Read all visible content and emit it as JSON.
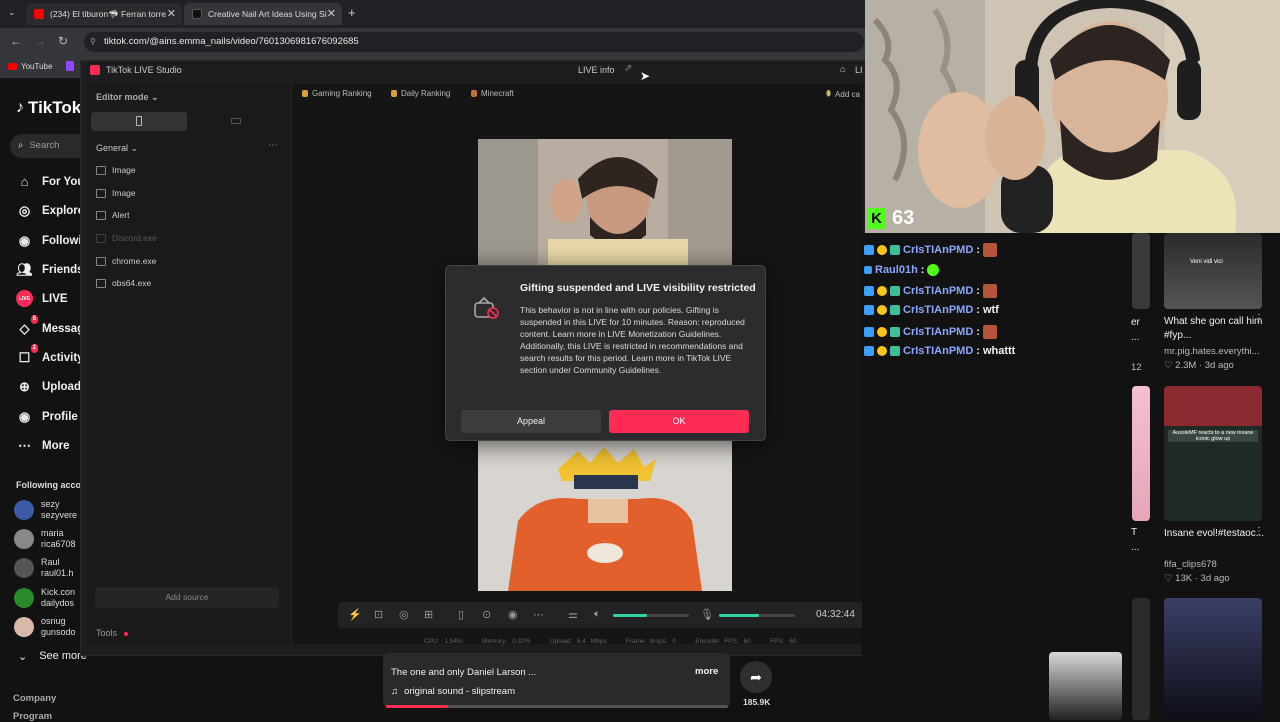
{
  "browser": {
    "tabs": [
      {
        "title": "(234) El tiburon🦈 Ferran torre",
        "favicon_color": "#ff0000"
      },
      {
        "title": "Creative Nail Art Ideas Using Si",
        "favicon_color": "#111111"
      }
    ],
    "url": "tiktok.com/@ains.emma_nails/video/7601306981676092685",
    "bookmarks": [
      {
        "label": "YouTube"
      }
    ]
  },
  "tiktok": {
    "logo": "TikTok",
    "search_placeholder": "Search",
    "nav": [
      {
        "label": "For You",
        "icon": "home-icon"
      },
      {
        "label": "Explore",
        "icon": "compass-icon"
      },
      {
        "label": "Following",
        "icon": "following-icon"
      },
      {
        "label": "Friends",
        "icon": "friends-icon"
      },
      {
        "label": "LIVE",
        "icon": "live-icon"
      },
      {
        "label": "Messages",
        "icon": "message-icon",
        "badge": "5"
      },
      {
        "label": "Activity",
        "icon": "activity-icon",
        "badge": "2"
      },
      {
        "label": "Upload",
        "icon": "upload-icon"
      },
      {
        "label": "Profile",
        "icon": "profile-icon"
      },
      {
        "label": "More",
        "icon": "more-icon"
      }
    ],
    "following_header": "Following acco",
    "following": [
      {
        "name": "sezy",
        "handle": "sezyvere"
      },
      {
        "name": "maria",
        "handle": "rica6708"
      },
      {
        "name": "Raul",
        "handle": "raul01.h"
      },
      {
        "name": "Kick.con",
        "handle": "dailydos"
      },
      {
        "name": "osnug",
        "handle": "gunsodo"
      }
    ],
    "see_more": "See more",
    "footer": [
      "Company",
      "Program"
    ]
  },
  "studio": {
    "app_title": "TikTok LIVE Studio",
    "live_info": "LIVE info",
    "right_clip": "LI",
    "add_label": "Add ca",
    "editor_mode": "Editor mode",
    "general": "General",
    "sources": [
      {
        "label": "Image",
        "dim": false
      },
      {
        "label": "Image",
        "dim": false
      },
      {
        "label": "Alert",
        "dim": false
      },
      {
        "label": "Discord.exe",
        "dim": true
      },
      {
        "label": "chrome.exe",
        "dim": false
      },
      {
        "label": "obs64.exe",
        "dim": false
      }
    ],
    "add_source": "Add source",
    "tools": "Tools",
    "rankings": [
      "Gaming Ranking",
      "Daily Ranking",
      "Minecraft"
    ],
    "timer": "04:32:44",
    "stats": {
      "cpu": "CPU: 1.54%",
      "memory": "Memory: 0.32%",
      "upload": "Upload: 5.4 Mbps",
      "frame_drops": "Frame drops: 0",
      "encoder_fps": "Encoder FPS: 60",
      "fps": "FPS: 60"
    },
    "volume_level": 0.45,
    "mic_level": 0.52
  },
  "modal": {
    "title": "Gifting suspended and LIVE visibility restricted",
    "body": "This behavior is not in line with our policies. Gifting is suspended in this LIVE for 10 minutes. Reason: reproduced content. Learn more in LIVE Monetization Guidelines. Additionally, this LIVE is restricted in recommendations and search results for this period. Learn more in TikTok LIVE section under Community Guidelines.",
    "appeal": "Appeal",
    "ok": "OK"
  },
  "overlay": {
    "kick_count": "63",
    "chat": [
      {
        "user": "CrIsTIAnPMD",
        "msg": "",
        "emote": true
      },
      {
        "user": "Raul01h",
        "msg": "",
        "emote_green": true
      },
      {
        "user": "CrIsTIAnPMD",
        "msg": "",
        "emote": true
      },
      {
        "user": "CrIsTIAnPMD",
        "msg": "wtf",
        "emote": false
      },
      {
        "user": "CrIsTIAnPMD",
        "msg": "",
        "emote": true
      },
      {
        "user": "CrIsTIAnPMD",
        "msg": "whattt",
        "emote": false
      }
    ]
  },
  "videos": [
    {
      "title": "What she gon call him #fyp...",
      "author": "mr.pig.hates.everythi...",
      "views": "2.3M",
      "age": "3d ago",
      "caption": "Veni vidi vici"
    },
    {
      "title": "Insane evol!#testaoc...",
      "author": "fifa_clips678",
      "views": "13K",
      "age": "3d ago",
      "caption": "AussieMF reacts to a new insane iconic glow up"
    }
  ],
  "partial_titles": [
    "er",
    "...",
    "12",
    "T",
    "..."
  ],
  "player": {
    "caption": "The one and only Daniel Larson ...",
    "more": "more",
    "sound": "original sound - slipstream",
    "shares": "185.9K"
  }
}
